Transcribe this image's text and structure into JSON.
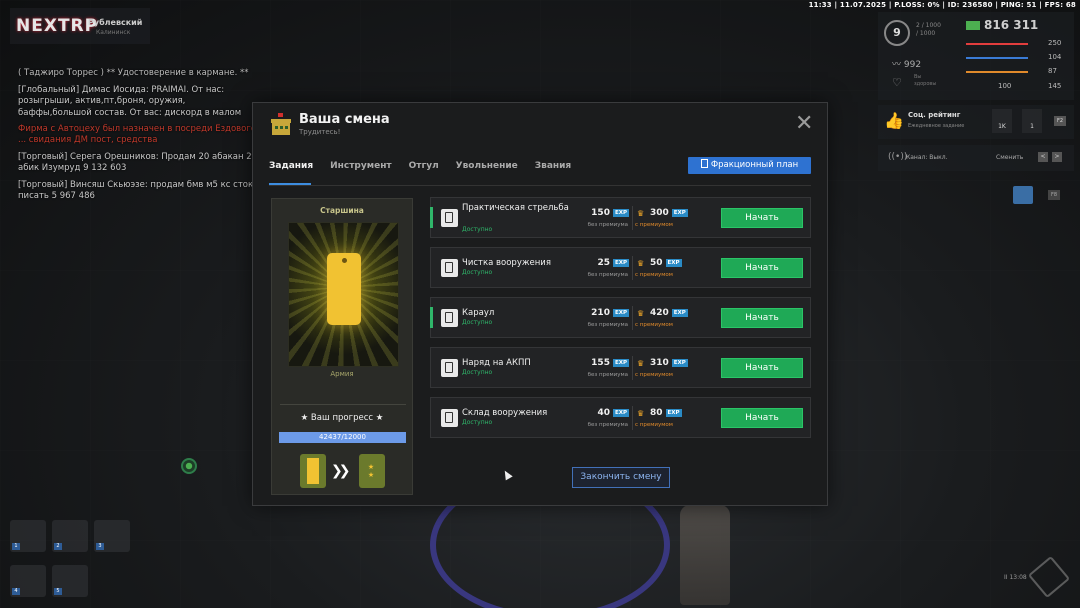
{
  "status_bar": "11:33 | 11.07.2025 | P.LOSS: 0% | ID: 236580 | PING: 51 | FPS: 68",
  "logo": {
    "text": "NEXTRP",
    "username": "Рублевский",
    "subtitle": "Калининск"
  },
  "hud": {
    "level": "9",
    "exp_line1": "2 / 1000",
    "exp_line2": "/ 1000",
    "money": "816 311",
    "armor": "992",
    "heart_label_1": "Вы",
    "heart_label_2": "здоровы",
    "stats": [
      {
        "value": "250",
        "color": "#e23d3d"
      },
      {
        "value": "104",
        "color": "#3a7bd5"
      },
      {
        "value": "87",
        "color": "#e08a2b"
      },
      {
        "value": "100",
        "color": "#888888"
      }
    ],
    "extra_stat": "145"
  },
  "social": {
    "title": "Соц. рейтинг",
    "subtitle": "Ежедневное задание",
    "box1": "1K",
    "box2": "1",
    "key": "F2"
  },
  "channel": {
    "label": "Канал: Выкл.",
    "change": "Сменить",
    "key1": "<",
    "key2": ">"
  },
  "side_key": "F8",
  "chat": [
    {
      "text": "( Таджиро Торрес ) ** Удостоверение в кармане. **",
      "cls": "grey"
    },
    {
      "text": "[Глобальный] Димас Йосида:  PRAIMAI. От нас: розыгрыши, актив,пт,броня, оружия, баффы,большой состав. От вас: дискорд в малом кол-ве, адекватность",
      "cls": ""
    },
    {
      "text": "Фирма с Автоцеху был назначен в посреди Ездового ... свидания ДМ пост, средства",
      "cls": "red"
    },
    {
      "text": "[Торговый] Серега Орешников: Продам 20 абакан 2т абик Изумруд  9 132 603",
      "cls": ""
    },
    {
      "text": "[Торговый] Винсяш Скьюэзе: продам бмв м5 кс сток писать  5 967 486",
      "cls": ""
    }
  ],
  "modal": {
    "title": "Ваша смена",
    "subtitle": "Трудитесь!",
    "close": "✕",
    "tabs": [
      "Задания",
      "Инструмент",
      "Отгул",
      "Увольнение",
      "Звания"
    ],
    "faction_plan": "Фракционный план",
    "card": {
      "rank_title": "Старшина",
      "faction": "Армия",
      "progress_label": "★ Ваш прогресс ★",
      "progress_text": "42437/12000",
      "progress_fraction": 1.0
    },
    "tasks": [
      {
        "name": "Практическая стрельба",
        "status": "Доступно",
        "exp": "150",
        "exp_prem": "300",
        "button": "Начать"
      },
      {
        "name": "Чистка вооружения",
        "status": "Доступно",
        "exp": "25",
        "exp_prem": "50",
        "button": "Начать"
      },
      {
        "name": "Караул",
        "status": "Доступно",
        "exp": "210",
        "exp_prem": "420",
        "button": "Начать"
      },
      {
        "name": "Наряд на АКПП",
        "status": "Доступно",
        "exp": "155",
        "exp_prem": "310",
        "button": "Начать"
      },
      {
        "name": "Склад вооружения",
        "status": "Доступно",
        "exp": "40",
        "exp_prem": "80",
        "button": "Начать"
      }
    ],
    "exp_tag": "EXP",
    "no_premium": "без премиума",
    "with_premium": "с премиумом",
    "finish": "Закончить смену"
  },
  "bottom_right_time": "II 13:08",
  "inventory_slots": [
    "1",
    "2",
    "3",
    "4",
    "5"
  ]
}
